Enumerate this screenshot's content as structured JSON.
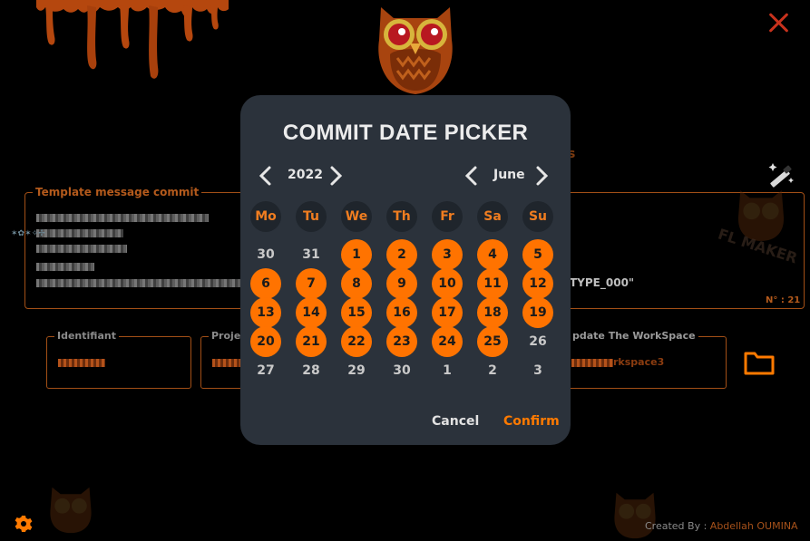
{
  "app": {
    "header_fragment": "s",
    "template_label": "Template message commit",
    "template_type_fragment": "TYPE_000\"",
    "template_number": "N° : 21",
    "fields": {
      "identifiant_label": "Identifiant",
      "project_label_fragment": "Proje",
      "workspace_label_fragment": "pdate The WorkSpace",
      "workspace_value_fragment": "rkspace3"
    },
    "footer": {
      "prefix": "Created By :",
      "author": "Abdellah OUMINA"
    },
    "side_glyphs": "✶✿✶✧✢"
  },
  "dialog": {
    "title": "COMMIT DATE PICKER",
    "year": "2022",
    "month": "June",
    "weekdays": [
      "Mo",
      "Tu",
      "We",
      "Th",
      "Fr",
      "Sa",
      "Su"
    ],
    "weeks": [
      [
        {
          "d": "30",
          "on": false
        },
        {
          "d": "31",
          "on": false
        },
        {
          "d": "1",
          "on": true
        },
        {
          "d": "2",
          "on": true
        },
        {
          "d": "3",
          "on": true
        },
        {
          "d": "4",
          "on": true
        },
        {
          "d": "5",
          "on": true
        }
      ],
      [
        {
          "d": "6",
          "on": true
        },
        {
          "d": "7",
          "on": true
        },
        {
          "d": "8",
          "on": true
        },
        {
          "d": "9",
          "on": true
        },
        {
          "d": "10",
          "on": true
        },
        {
          "d": "11",
          "on": true
        },
        {
          "d": "12",
          "on": true
        }
      ],
      [
        {
          "d": "13",
          "on": true
        },
        {
          "d": "14",
          "on": true
        },
        {
          "d": "15",
          "on": true
        },
        {
          "d": "16",
          "on": true
        },
        {
          "d": "17",
          "on": true
        },
        {
          "d": "18",
          "on": true
        },
        {
          "d": "19",
          "on": true
        }
      ],
      [
        {
          "d": "20",
          "on": true
        },
        {
          "d": "21",
          "on": true
        },
        {
          "d": "22",
          "on": true
        },
        {
          "d": "23",
          "on": true
        },
        {
          "d": "24",
          "on": true
        },
        {
          "d": "25",
          "on": true
        },
        {
          "d": "26",
          "on": false
        }
      ],
      [
        {
          "d": "27",
          "on": false
        },
        {
          "d": "28",
          "on": false
        },
        {
          "d": "29",
          "on": false
        },
        {
          "d": "30",
          "on": false
        },
        {
          "d": "1",
          "on": false
        },
        {
          "d": "2",
          "on": false
        },
        {
          "d": "3",
          "on": false
        }
      ]
    ],
    "cancel_label": "Cancel",
    "confirm_label": "Confirm"
  },
  "colors": {
    "accent": "#ff7300",
    "dialog_bg": "#2b323b",
    "weekday_bg": "#1f252c",
    "border": "#a24f16"
  },
  "icons": [
    "close-icon",
    "wand-icon",
    "folder-icon",
    "gear-icon",
    "chevron-left-icon",
    "chevron-right-icon"
  ]
}
